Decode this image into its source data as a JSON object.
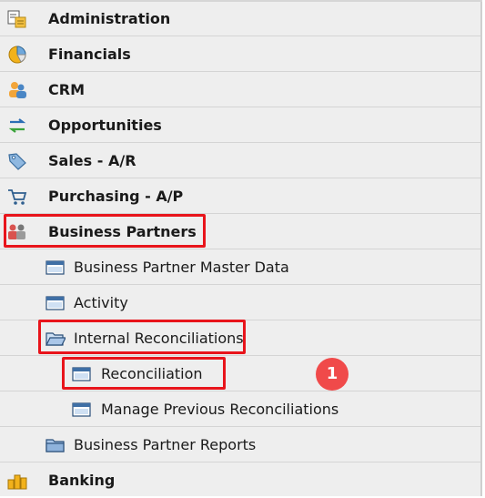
{
  "menu": {
    "administration": "Administration",
    "financials": "Financials",
    "crm": "CRM",
    "opportunities": "Opportunities",
    "sales": "Sales - A/R",
    "purchasing": "Purchasing - A/P",
    "business_partners": "Business Partners",
    "bp_master_data": "Business Partner Master Data",
    "activity": "Activity",
    "internal_reconciliations": "Internal Reconciliations",
    "reconciliation": "Reconciliation",
    "manage_previous": "Manage Previous Reconciliations",
    "bp_reports": "Business Partner Reports",
    "banking": "Banking"
  },
  "callout": {
    "step": "1"
  },
  "colors": {
    "highlight": "#e8141b",
    "badge": "#f04a4a",
    "panel": "#eeeeee"
  }
}
